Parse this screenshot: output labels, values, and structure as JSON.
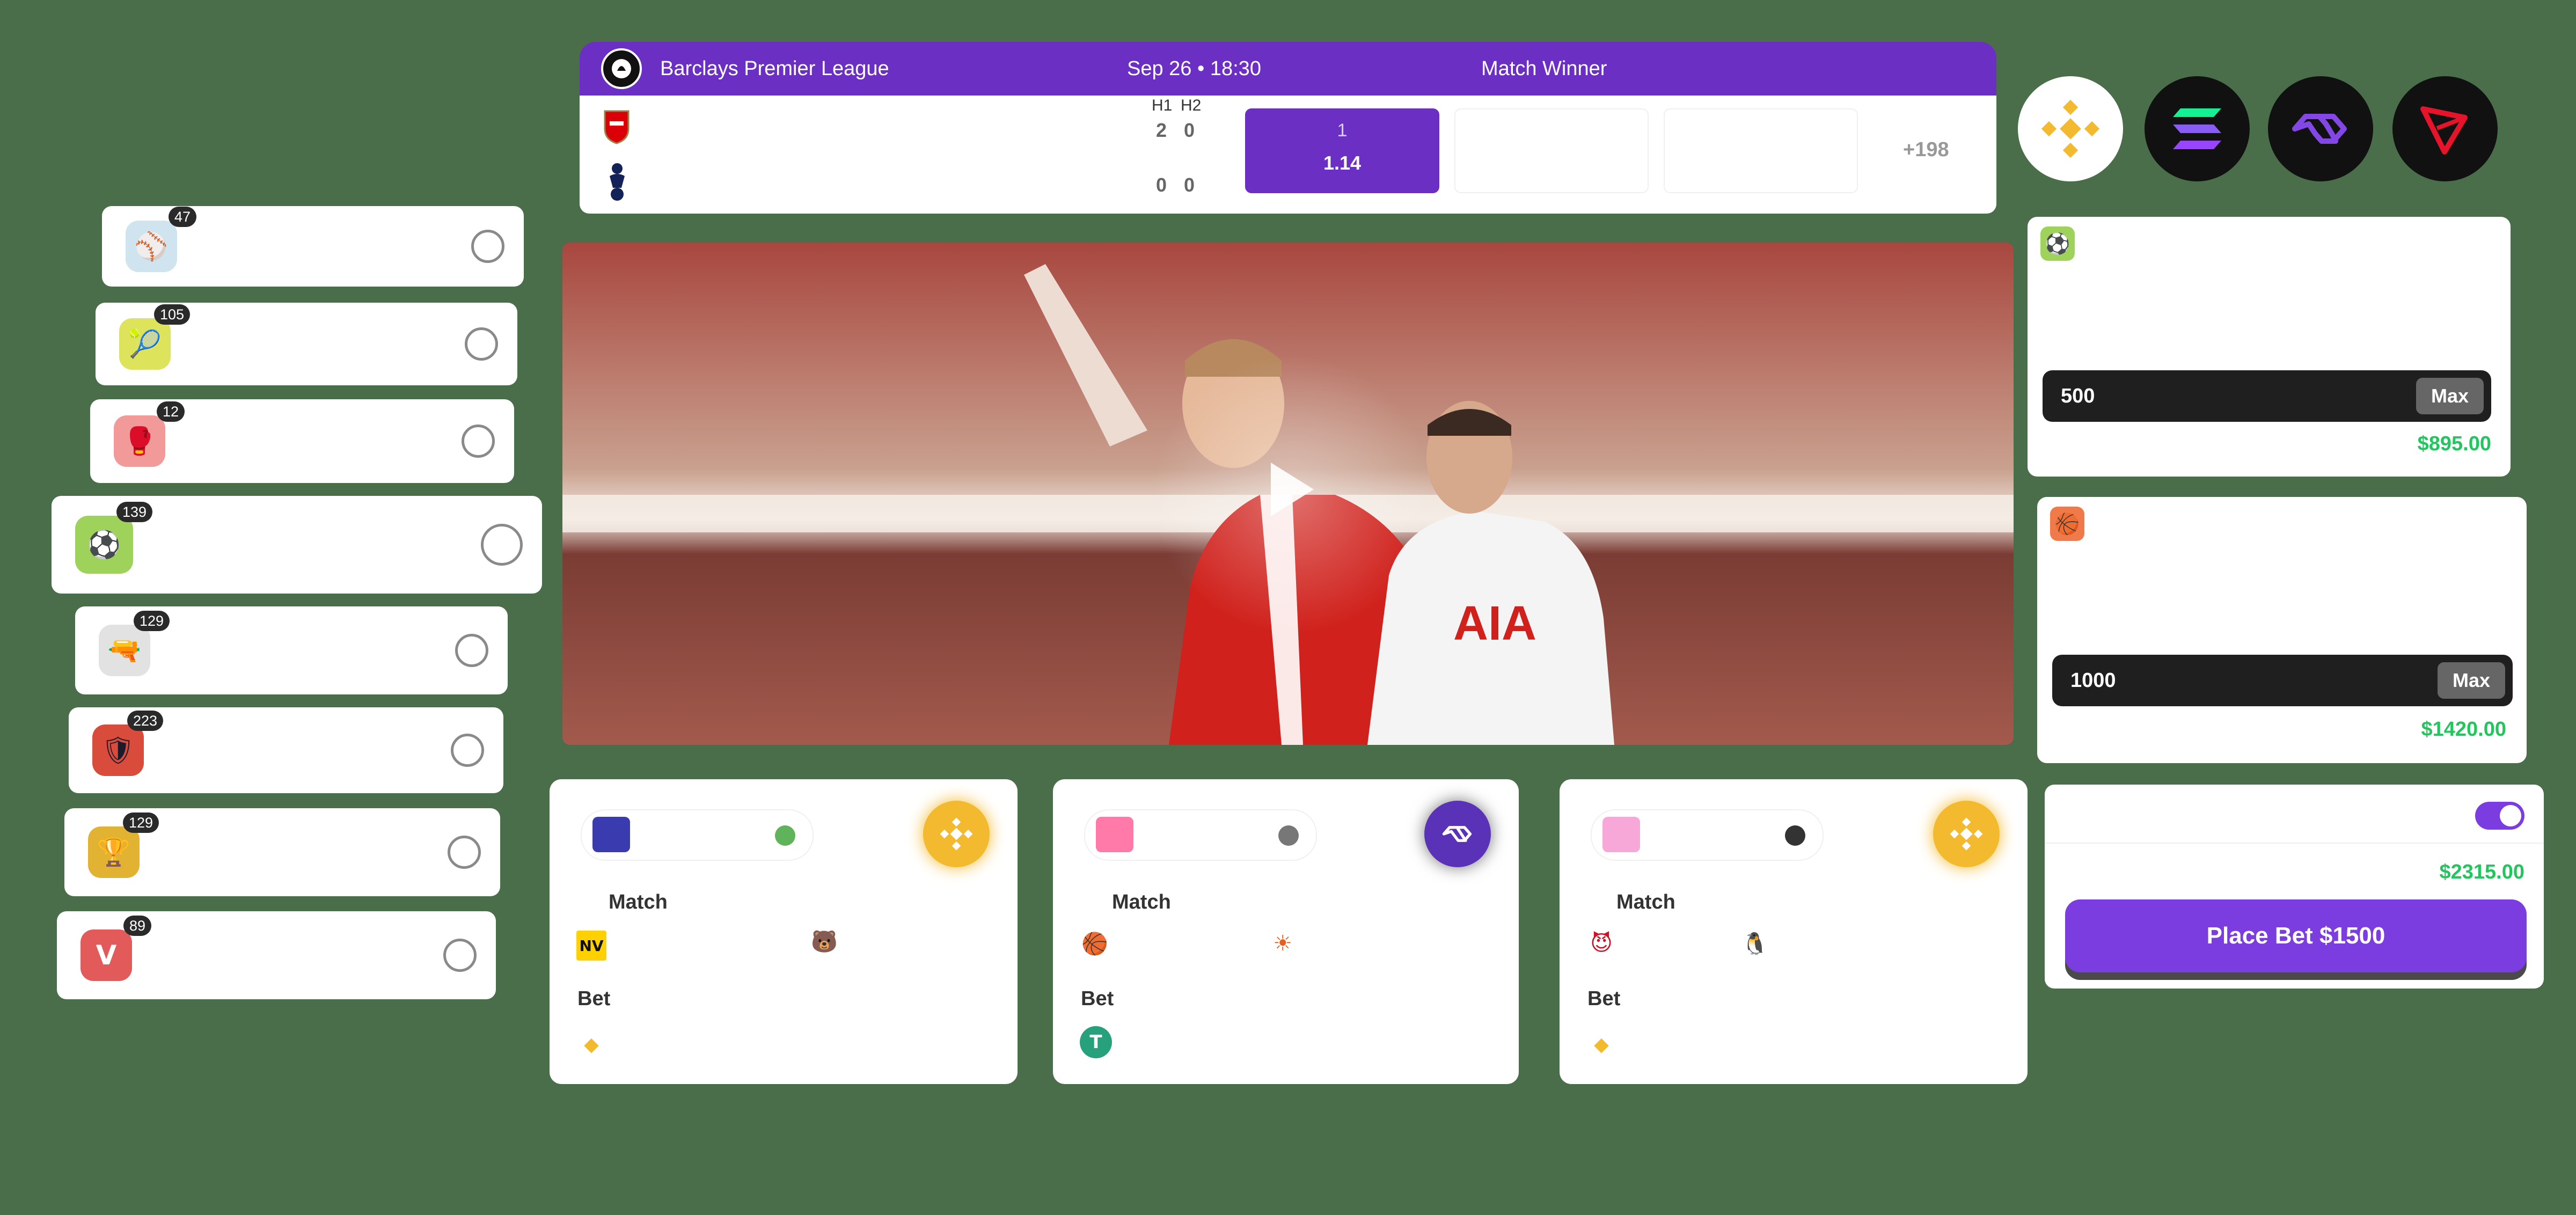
{
  "sports": [
    {
      "count": "47",
      "name": "",
      "emoji": "⚾",
      "bg": "#cfe4ef"
    },
    {
      "count": "105",
      "name": "",
      "emoji": "🎾",
      "bg": "#dde35a"
    },
    {
      "count": "12",
      "name": "",
      "emoji": "🥊",
      "bg": "#f29a9a"
    },
    {
      "count": "139",
      "name": "",
      "emoji": "⚽",
      "bg": "#9ed25a"
    },
    {
      "count": "129",
      "name": "",
      "emoji": "🔫",
      "bg": "#e2e2e2"
    },
    {
      "count": "223",
      "name": "",
      "emoji": "🛡",
      "bg": "#d94c3c"
    },
    {
      "count": "129",
      "name": "",
      "emoji": "🏆",
      "bg": "#e2b233"
    },
    {
      "count": "89",
      "name": "",
      "emoji": "V",
      "bg": "#e25a5a"
    }
  ],
  "match": {
    "league": "Barclays Premier League",
    "datetime": "Sep 26 • 18:30",
    "market": "Match Winner",
    "h1": "H1",
    "h2": "H2",
    "home": {
      "name": "",
      "h1": "2",
      "h2": "0"
    },
    "away": {
      "name": "",
      "h1": "0",
      "h2": "0"
    },
    "odd_label": "1",
    "odd_value": "1.14",
    "more": "+198"
  },
  "coins": [
    {
      "name": "bnb-icon",
      "bg": "#ffffff",
      "color": "#f3ba2f"
    },
    {
      "name": "solana-icon",
      "bg": "#111111",
      "color": "#9945ff"
    },
    {
      "name": "polygon-icon",
      "bg": "#111111",
      "color": "#8247e5"
    },
    {
      "name": "tron-icon",
      "bg": "#111111",
      "color": "#e5142a"
    }
  ],
  "bet_cards": [
    {
      "match_label": "Match",
      "bet_label": "Bet",
      "coin": "bnb",
      "team1": "NaVi",
      "team2": "Virtus.pro"
    },
    {
      "match_label": "Match",
      "bet_label": "Bet",
      "coin": "polygon",
      "team1": "Lakers",
      "team2": "Suns"
    },
    {
      "match_label": "Match",
      "bet_label": "Bet",
      "coin": "bnb",
      "team1": "Devils",
      "team2": "Penguins"
    }
  ],
  "slip": [
    {
      "amount": "500",
      "max_label": "Max",
      "payout": "$895.00"
    },
    {
      "amount": "1000",
      "max_label": "Max",
      "payout": "$1420.00"
    }
  ],
  "total_payout": "$2315.00",
  "place_bet_label": "Place Bet $1500",
  "colors": {
    "primary": "#6b2fc4",
    "button": "#7b3ce0",
    "green": "#22c55e"
  }
}
